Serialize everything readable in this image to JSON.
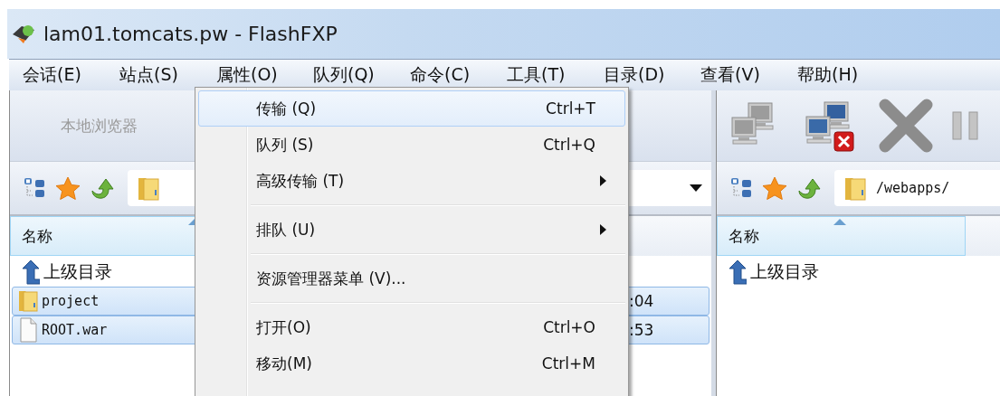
{
  "window": {
    "title": "lam01.tomcats.pw - FlashFXP"
  },
  "menu_bar": [
    "会话(E)",
    "站点(S)",
    "属性(O)",
    "队列(Q)",
    "命令(C)",
    "工具(T)",
    "目录(D)",
    "查看(V)",
    "帮助(H)"
  ],
  "left_pane": {
    "browser_button": {
      "label": "本地浏览器",
      "disabled": true
    },
    "columns": [
      "名称"
    ],
    "rows": [
      {
        "kind": "parent",
        "name": "上级目录",
        "selected": false
      },
      {
        "kind": "folder",
        "name": "project",
        "column_2": ":04",
        "selected": true
      },
      {
        "kind": "file",
        "name": "ROOT.war",
        "column_2": ":53",
        "selected": true
      }
    ]
  },
  "right_pane": {
    "path": "/webapps/",
    "columns": [
      "名称"
    ],
    "rows": [
      {
        "kind": "parent",
        "name": "上级目录",
        "selected": false
      }
    ]
  },
  "context_menu": {
    "items": [
      {
        "kind": "item",
        "label": "传输 (Q)",
        "shortcut": "Ctrl+T",
        "submenu": false,
        "selected": true
      },
      {
        "kind": "item",
        "label": "队列 (S)",
        "shortcut": "Ctrl+Q",
        "submenu": false,
        "selected": false
      },
      {
        "kind": "item",
        "label": "高级传输 (T)",
        "submenu": true,
        "selected": false
      },
      {
        "kind": "separator"
      },
      {
        "kind": "item",
        "label": "排队 (U)",
        "submenu": true,
        "selected": false
      },
      {
        "kind": "separator"
      },
      {
        "kind": "item",
        "label": "资源管理器菜单 (V)...",
        "submenu": false,
        "selected": false
      },
      {
        "kind": "separator"
      },
      {
        "kind": "item",
        "label": "打开(O)",
        "shortcut": "Ctrl+O",
        "submenu": false,
        "selected": false
      },
      {
        "kind": "item",
        "label": "移动(M)",
        "shortcut": "Ctrl+M",
        "submenu": false,
        "selected": false
      }
    ]
  }
}
